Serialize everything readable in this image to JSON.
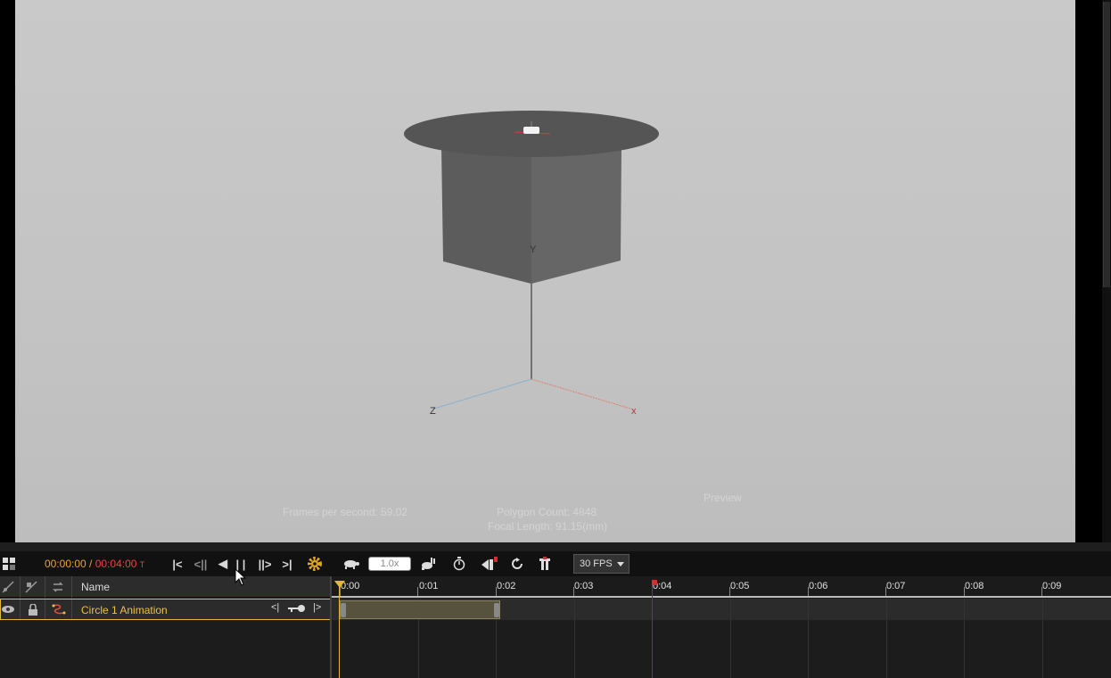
{
  "viewport": {
    "stats": {
      "fps": "Frames per second: 59.02",
      "polygons": "Polygon Count: 4848",
      "focal": "Focal Length: 91.15(mm)",
      "mode": "Preview"
    },
    "axes": {
      "x": "x",
      "y": "Y",
      "z": "Z"
    }
  },
  "transport": {
    "time_current": "00:00:00",
    "time_sep": " / ",
    "time_total": "00:04:00",
    "time_suffix": "T",
    "buttons": {
      "first": ">|",
      "prev_key": "<||",
      "reverse": "◀",
      "pause": "||",
      "next_key": "||>",
      "last": ">|"
    },
    "speed_value": "1.0x",
    "fps_select": "30 FPS"
  },
  "tracks": {
    "name_header": "Name",
    "rows": [
      {
        "name": "Circle 1 Animation",
        "prev": "<|",
        "next": "|>"
      }
    ]
  },
  "ruler": {
    "labels": [
      "0:00",
      "0:01",
      "0:02",
      "0:03",
      "0:04",
      "0:05",
      "0:06",
      "0:07",
      "0:08",
      "0:09"
    ]
  },
  "colors": {
    "accent": "#e0b83a",
    "time_total": "#e84444",
    "end_marker": "#b02020"
  }
}
